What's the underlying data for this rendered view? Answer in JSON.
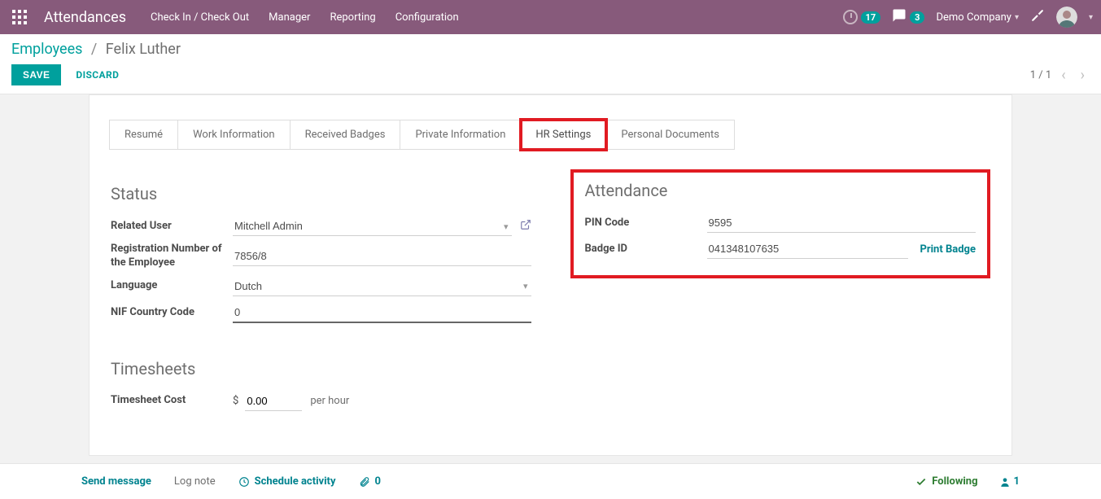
{
  "topbar": {
    "app_title": "Attendances",
    "nav": [
      "Check In / Check Out",
      "Manager",
      "Reporting",
      "Configuration"
    ],
    "timer_badge": "17",
    "chat_badge": "3",
    "company": "Demo Company"
  },
  "breadcrumb": {
    "root": "Employees",
    "current": "Felix Luther"
  },
  "buttons": {
    "save": "SAVE",
    "discard": "DISCARD"
  },
  "pager": {
    "text": "1 / 1"
  },
  "tabs": [
    "Resumé",
    "Work Information",
    "Received Badges",
    "Private Information",
    "HR Settings",
    "Personal Documents"
  ],
  "status": {
    "heading": "Status",
    "related_user_label": "Related User",
    "related_user_value": "Mitchell Admin",
    "reg_number_label": "Registration Number of the Employee",
    "reg_number_value": "7856/8",
    "language_label": "Language",
    "language_value": "Dutch",
    "nif_label": "NIF Country Code",
    "nif_value": "0"
  },
  "attendance": {
    "heading": "Attendance",
    "pin_label": "PIN Code",
    "pin_value": "9595",
    "badge_label": "Badge ID",
    "badge_value": "041348107635",
    "print_badge": "Print Badge"
  },
  "timesheets": {
    "heading": "Timesheets",
    "cost_label": "Timesheet Cost",
    "currency": "$",
    "cost_value": "0.00",
    "suffix": "per hour"
  },
  "chatter": {
    "send": "Send message",
    "log": "Log note",
    "schedule": "Schedule activity",
    "attachments": "0",
    "following": "Following",
    "followers": "1"
  }
}
